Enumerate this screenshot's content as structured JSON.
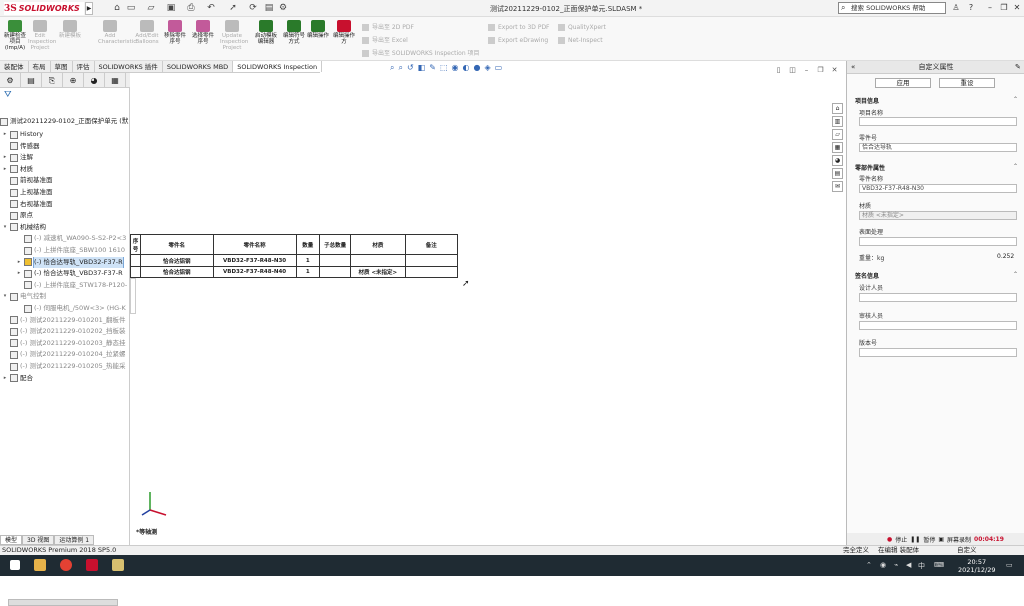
{
  "app": {
    "logo_ds": "3S",
    "logo_text": "SOLIDWORKS",
    "doc_title": "测试20211229-0102_正面保护单元.SLDASM *",
    "search_placeholder": "搜索 SOLIDWORKS 帮助"
  },
  "ribbon": {
    "buttons": [
      {
        "label": "新建检查项目(lmp/A)",
        "enabled": true,
        "color": "#3a8f3a"
      },
      {
        "label": "Edit Inspection Project",
        "enabled": false,
        "color": "#bbb"
      },
      {
        "label": "新建模板",
        "enabled": false,
        "color": "#bbb"
      },
      {
        "label": "Add Characteristic",
        "enabled": false,
        "color": "#bbb"
      },
      {
        "label": "Add/Edit Balloons",
        "enabled": false,
        "color": "#bbb"
      },
      {
        "label": "移除零件序号",
        "enabled": true,
        "color": "#c25a9a"
      },
      {
        "label": "选择零件序号",
        "enabled": true,
        "color": "#c25a9a"
      },
      {
        "label": "Update Inspection Project",
        "enabled": false,
        "color": "#bbb"
      },
      {
        "label": "启动模板编辑器",
        "enabled": true,
        "color": "#2a7a2a"
      },
      {
        "label": "编辑符号方式",
        "enabled": true,
        "color": "#2a7a2a"
      },
      {
        "label": "编辑操作",
        "enabled": true,
        "color": "#2a7a2a"
      },
      {
        "label": "编辑操作方",
        "enabled": true,
        "color": "#c8102e"
      }
    ],
    "small_col1": [
      "导出至 2D PDF",
      "导出至 Excel",
      "导出至 SOLIDWORKS Inspection 项目"
    ],
    "small_col2": [
      "Export to 3D PDF",
      "Export eDrawing"
    ],
    "small_col3": [
      "QualityXpert",
      "Net-Inspect"
    ]
  },
  "tabs": [
    "装配体",
    "布局",
    "草图",
    "评估",
    "SOLIDWORKS 插件",
    "SOLIDWORKS MBD",
    "SOLIDWORKS Inspection"
  ],
  "active_tab": "SOLIDWORKS Inspection",
  "tree": {
    "root": "测试20211229-0102_正面保护单元 (默",
    "items": [
      {
        "label": "History",
        "indent": 1,
        "exp": "▸",
        "grey": false,
        "sel": false
      },
      {
        "label": "传感器",
        "indent": 1,
        "exp": "",
        "grey": false,
        "sel": false
      },
      {
        "label": "注解",
        "indent": 1,
        "exp": "▸",
        "grey": false,
        "sel": false
      },
      {
        "label": "材质",
        "indent": 1,
        "exp": "▸",
        "grey": false,
        "sel": false
      },
      {
        "label": "前视基准面",
        "indent": 1,
        "exp": "",
        "grey": false,
        "sel": false
      },
      {
        "label": "上视基准面",
        "indent": 1,
        "exp": "",
        "grey": false,
        "sel": false
      },
      {
        "label": "右视基准面",
        "indent": 1,
        "exp": "",
        "grey": false,
        "sel": false
      },
      {
        "label": "原点",
        "indent": 1,
        "exp": "",
        "grey": false,
        "sel": false
      },
      {
        "label": "机械结构",
        "indent": 1,
        "exp": "▾",
        "grey": false,
        "sel": false
      },
      {
        "label": "(-) 减速机_WA090-S-S2-P2<3",
        "indent": 2,
        "exp": "",
        "grey": true,
        "sel": false
      },
      {
        "label": "(-) 上拼件底座_SBW100 1610",
        "indent": 2,
        "exp": "",
        "grey": true,
        "sel": false
      },
      {
        "label": "(-) 恰合达导轨_VBD32-F37-R",
        "indent": 2,
        "exp": "▸",
        "grey": false,
        "sel": true
      },
      {
        "label": "(-) 恰合达导轨_VBD37-F37-R",
        "indent": 2,
        "exp": "▸",
        "grey": false,
        "sel": false
      },
      {
        "label": "(-) 上拼件底座_STW178-P120-",
        "indent": 2,
        "exp": "",
        "grey": true,
        "sel": false
      },
      {
        "label": "电气控制",
        "indent": 1,
        "exp": "▾",
        "grey": true,
        "sel": false
      },
      {
        "label": "(-) 伺服电机_/50W<3> (HG-K",
        "indent": 2,
        "exp": "",
        "grey": true,
        "sel": false
      },
      {
        "label": "(-) 测试20211229-010201_翻板件",
        "indent": 1,
        "exp": "",
        "grey": true,
        "sel": false
      },
      {
        "label": "(-) 测试20211229-010202_挡板装",
        "indent": 1,
        "exp": "",
        "grey": true,
        "sel": false
      },
      {
        "label": "(-) 测试20211229-010203_静态挂",
        "indent": 1,
        "exp": "",
        "grey": true,
        "sel": false
      },
      {
        "label": "(-) 测试20211229-010204_拉紧螺",
        "indent": 1,
        "exp": "",
        "grey": true,
        "sel": false
      },
      {
        "label": "(-) 测试20211229-010205_热能采",
        "indent": 1,
        "exp": "",
        "grey": true,
        "sel": false
      },
      {
        "label": "配合",
        "indent": 1,
        "exp": "▸",
        "grey": false,
        "sel": false
      }
    ]
  },
  "bom": {
    "headers": [
      "序号",
      "零件名",
      "零件名称",
      "数量",
      "子总数量",
      "材质",
      "备注"
    ],
    "rows": [
      [
        "",
        "恰合达铝钢",
        "VBD32-F37-R48-N30",
        "1",
        "",
        "",
        ""
      ],
      [
        "",
        "恰合达铝钢",
        "VBD32-F37-R48-N40",
        "1",
        "",
        "材质 <未指定>",
        ""
      ]
    ]
  },
  "canvas": {
    "view_label": "*等轴测"
  },
  "bottom_tabs": [
    "模型",
    "3D 视图",
    "运动算例 1"
  ],
  "right_panel": {
    "title": "自定义属性",
    "apply": "应用",
    "reset": "重设",
    "sec1": "项目信息",
    "project_name_label": "项目名称",
    "drawing_no_label": "零件号",
    "drawing_no_value": "恰合达导轨",
    "sec2": "零部件属性",
    "part_name_label": "零件名称",
    "part_name_value": "VBD32-F37-R48-N30",
    "material_label": "材质",
    "material_value": "材质 <未指定>",
    "surface_label": "表面处理",
    "weight_label": "重量：kg",
    "weight_value": "0.252",
    "sec3": "签名信息",
    "designer_label": "设计人员",
    "drafter_label": "审核人员",
    "version_label": "版本号",
    "stop_label": "停止",
    "pause_label": "暂停",
    "record_label": "屏幕录制",
    "time": "00:04:19"
  },
  "status": {
    "left": "SOLIDWORKS Premium 2018 SP5.0",
    "mid1": "完全定义",
    "mid2": "在编辑 装配体",
    "mid3": "自定义"
  },
  "taskbar": {
    "time": "20:57",
    "date": "2021/12/29"
  }
}
